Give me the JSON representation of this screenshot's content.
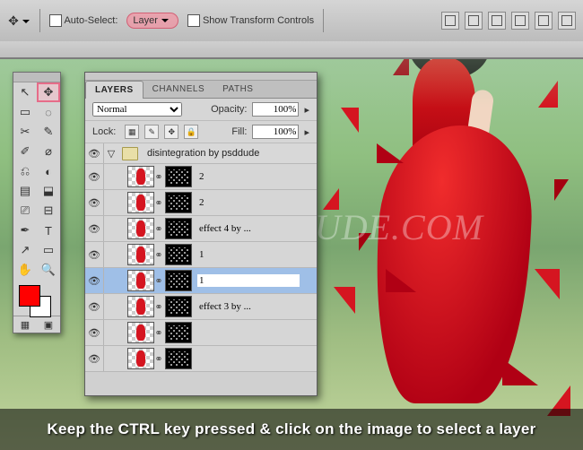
{
  "optionsBar": {
    "auto_select_label": "Auto-Select:",
    "target": "Layer",
    "show_transform_label": "Show Transform Controls"
  },
  "toolsPanel": {
    "tools": [
      "↖",
      "✥",
      "▭",
      "◌",
      "✂",
      "✎",
      "✐",
      "⌀",
      "⎌",
      "◐",
      "▤",
      "⬓",
      "⎚",
      "⊟",
      "✒",
      "T",
      "↗",
      "▭",
      "✋",
      "🔍"
    ],
    "foreground": "#ff0000",
    "background": "#ffffff"
  },
  "layersPanel": {
    "tabs": [
      "LAYERS",
      "CHANNELS",
      "PATHS"
    ],
    "activeTab": 0,
    "blendMode": "Normal",
    "opacity_label": "Opacity:",
    "opacity_value": "100%",
    "lock_label": "Lock:",
    "fill_label": "Fill:",
    "fill_value": "100%",
    "group_name": "disintegration by psddude",
    "layers": [
      {
        "name": "2",
        "selected": false
      },
      {
        "name": "2",
        "selected": false
      },
      {
        "name": "effect 4 by ...",
        "selected": false
      },
      {
        "name": "1",
        "selected": false
      },
      {
        "name": "1",
        "selected": true
      },
      {
        "name": "effect 3 by ...",
        "selected": false
      },
      {
        "name": "",
        "selected": false
      },
      {
        "name": "",
        "selected": false
      }
    ]
  },
  "watermark": "WWW.PSD-DUDE.COM",
  "caption": "Keep the CTRL key pressed & click on the image to select a layer"
}
